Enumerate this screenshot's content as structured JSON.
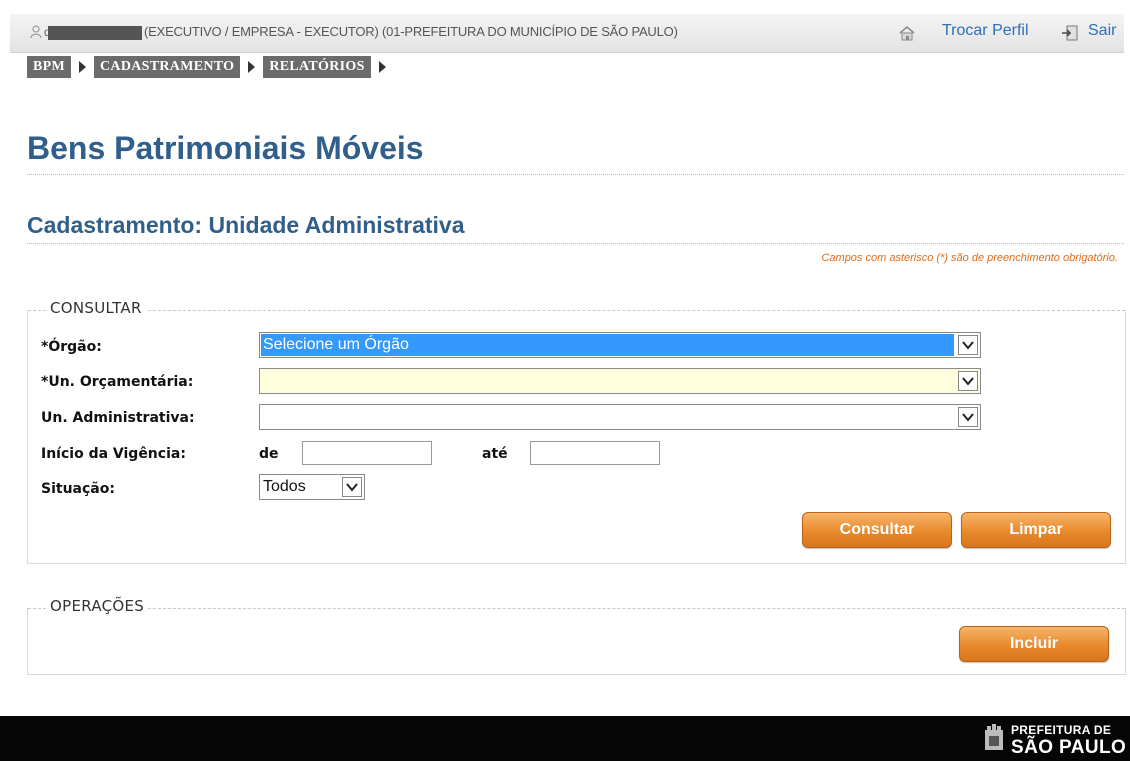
{
  "topbar": {
    "user_prefix": "d",
    "profile": "(EXECUTIVO / EMPRESA - EXECUTOR) (01-PREFEITURA DO MUNICÍPIO DE SÃO PAULO)",
    "switch_profile": "Trocar Perfil",
    "logout": "Sair"
  },
  "breadcrumb": [
    {
      "label": "BPM"
    },
    {
      "label": "CADASTRAMENTO"
    },
    {
      "label": "RELATÓRIOS"
    }
  ],
  "page_title": "Bens Patrimoniais Móveis",
  "section_title": "Cadastramento: Unidade Administrativa",
  "required_note": "Campos com asterisco (*) são de preenchimento obrigatório.",
  "consultar": {
    "legend": "CONSULTAR",
    "orgao_label": "*Órgão:",
    "orgao_value": "Selecione um Órgão",
    "un_orc_label": "*Un. Orçamentária:",
    "un_orc_value": "",
    "un_adm_label": "Un. Administrativa:",
    "un_adm_value": "",
    "vigencia_label": "Início da Vigência:",
    "de_label": "de",
    "ate_label": "até",
    "de_value": "",
    "ate_value": "",
    "situacao_label": "Situação:",
    "situacao_value": "Todos",
    "consultar_button": "Consultar",
    "limpar_button": "Limpar"
  },
  "operacoes": {
    "legend": "OPERAÇÕES",
    "incluir_button": "Incluir"
  },
  "footer": {
    "org_line1": "PREFEITURA DE",
    "org_line2": "SÃO PAULO"
  },
  "colors": {
    "title": "#2f5f8a",
    "link": "#2d6fb8",
    "button_orange": "#e8892c",
    "selected_blue": "#3399ff",
    "required_highlight": "#ffffdd",
    "note_orange": "#e06b1a"
  },
  "icons": {
    "user": "user-icon",
    "home": "home-icon",
    "exit": "exit-icon",
    "dropdown": "chevron-down-icon",
    "crumb_arrow": "triangle-right-icon",
    "seal": "city-seal-icon"
  }
}
